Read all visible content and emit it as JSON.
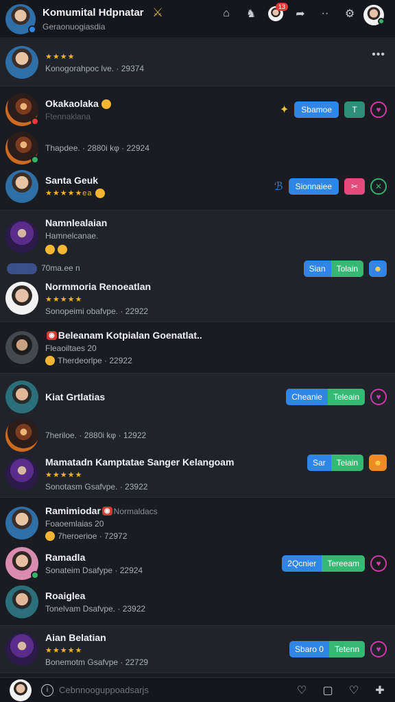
{
  "header": {
    "title": "Komumital Hdpnatar",
    "subtitle": "Geraonuogiasdia",
    "notification_count": "13"
  },
  "items": [
    {
      "name": "",
      "meta": "Konogorahpoc lve. · 29374",
      "stars": "★★★★",
      "avatar": "default",
      "has_more": true
    },
    {
      "name": "Okakaolaka",
      "meta": "Ftennaklana",
      "avatar": "hero",
      "actions": {
        "pill": "Sbamoe",
        "square": "T"
      }
    },
    {
      "name": "",
      "meta": "Thapdee. · 2880i kφ · 22924",
      "avatar": "hero"
    },
    {
      "name": "Santa Geuk",
      "meta": "★★★★★ea",
      "avatar": "default",
      "actions": {
        "pill": "Sionnaiee",
        "square": "✂"
      }
    },
    {
      "name": "Namnlealaian",
      "meta": "Hamnelcanae.",
      "avatar": "purple"
    },
    {
      "name": "",
      "meta": "70ma.ee n",
      "avatar": "none",
      "actions": {
        "split_a": "Sian",
        "split_b": "Tolain"
      }
    },
    {
      "name": "Normmoria Renoeatlan",
      "meta": "Sonopeimi obafvpe. · 22922",
      "stars": "★★★★★",
      "avatar": "light"
    },
    {
      "name": "Beleanam Kotpialan Goenatlat..",
      "meta": "Fleaoiltaes 20",
      "meta2": "Therdeorlpe · 22922",
      "avatar": "dark"
    },
    {
      "name": "Kiat Grtlatias",
      "meta": "",
      "avatar": "teal",
      "actions": {
        "split_a": "Cheanie",
        "split_b": "Teleain"
      }
    },
    {
      "name": "",
      "meta": "7heriloe. · 2880i kφ · 12922",
      "avatar": "hero"
    },
    {
      "name": "Mamatadn Kamptatae Sanger Kelangoam",
      "meta": "Sonotasm Gsafvpe. · 23922",
      "stars": "★★★★★",
      "avatar": "purple",
      "actions": {
        "split_a": "Sar",
        "split_b": "Teiain"
      }
    },
    {
      "name": "Ramimiodar",
      "tag_text": "Normaldacs",
      "meta": "Foaoemlaias 20",
      "meta2": "7heroerioe · 72972",
      "avatar": "default"
    },
    {
      "name": "Ramadla",
      "meta": "Sonateim Dsafype · 22924",
      "avatar": "pink",
      "actions": {
        "split_a": "2Qcnier",
        "split_b": "Tereeam"
      }
    },
    {
      "name": "Roaiglea",
      "meta": "Tonelvam Dsafvpe. · 23922",
      "avatar": "teal"
    },
    {
      "name": "Aian Belatian",
      "meta": "Bonemotm Gsafvpe · 22729",
      "stars": "★★★★★",
      "avatar": "purple",
      "actions": {
        "split_a": "Sbaro 0",
        "split_b": "Tetenn"
      }
    }
  ],
  "bottom": {
    "search_placeholder": "Cebnnooguppoadsarjs"
  },
  "colors": {
    "background": "#1a1c22",
    "accent_blue": "#2f86e6",
    "accent_green": "#35b872",
    "star": "#f0b429",
    "ring_pink": "#cf3aa6"
  }
}
